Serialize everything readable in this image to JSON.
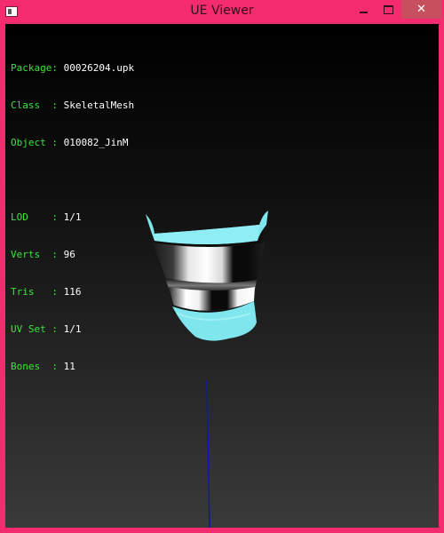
{
  "window": {
    "title": "UE Viewer",
    "colors": {
      "frame": "#f42b6e",
      "close_button": "#c7505f",
      "label_green": "#39e639",
      "value_white": "#ffffff",
      "mesh_cyan": "#7fe6ee",
      "axis_blue": "#1414b4"
    }
  },
  "info": {
    "package_label": "Package:",
    "package_value": "00026204.upk",
    "class_label": "Class  :",
    "class_value": "SkeletalMesh",
    "object_label": "Object :",
    "object_value": "010082_JinM",
    "lod_label": "LOD    :",
    "lod_value": "1/1",
    "verts_label": "Verts  :",
    "verts_value": "96",
    "tris_label": "Tris   :",
    "tris_value": "116",
    "uvset_label": "UV Set :",
    "uvset_value": "1/1",
    "bones_label": "Bones  :",
    "bones_value": "11"
  },
  "icons": {
    "app": "app-icon",
    "minimize": "minimize-icon",
    "maximize": "maximize-icon",
    "close": "close-icon"
  }
}
